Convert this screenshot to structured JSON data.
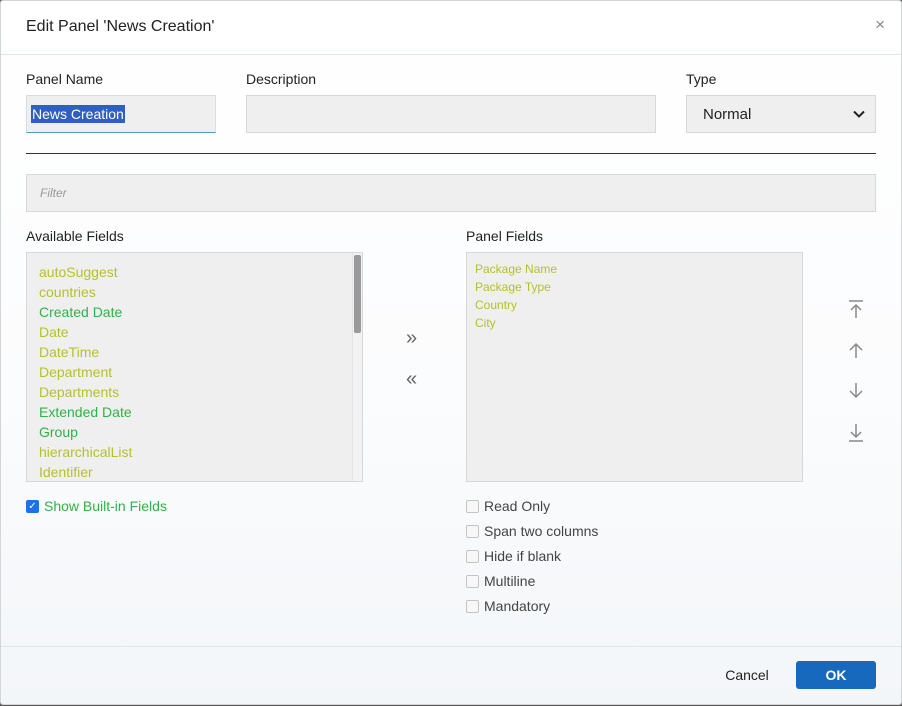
{
  "dialog": {
    "title": "Edit Panel 'News Creation'",
    "close_glyph": "×"
  },
  "form": {
    "panel_name_label": "Panel Name",
    "panel_name_value": "News Creation",
    "description_label": "Description",
    "description_value": "",
    "type_label": "Type",
    "type_value": "Normal",
    "filter_placeholder": "Filter"
  },
  "available_fields": {
    "label": "Available Fields",
    "items": [
      {
        "label": "autoSuggest",
        "color": "#b5c12a"
      },
      {
        "label": "countries",
        "color": "#b5c12a"
      },
      {
        "label": "Created Date",
        "color": "#2fb346"
      },
      {
        "label": "Date",
        "color": "#b5c12a"
      },
      {
        "label": "DateTime",
        "color": "#b5c12a"
      },
      {
        "label": "Department",
        "color": "#b5c12a"
      },
      {
        "label": "Departments",
        "color": "#b5c12a"
      },
      {
        "label": "Extended Date",
        "color": "#2fb346"
      },
      {
        "label": "Group",
        "color": "#2fb346"
      },
      {
        "label": "hierarchicalList",
        "color": "#b5c12a"
      },
      {
        "label": "Identifier",
        "color": "#b5c12a"
      }
    ]
  },
  "panel_fields": {
    "label": "Panel Fields",
    "items": [
      {
        "label": "Package Name",
        "color": "#b5c12a"
      },
      {
        "label": "Package Type",
        "color": "#b5c12a"
      },
      {
        "label": "Country",
        "color": "#b5c12a"
      },
      {
        "label": "City",
        "color": "#b5c12a"
      }
    ]
  },
  "transfer": {
    "add_glyph": "»",
    "remove_glyph": "«"
  },
  "order_icons": [
    "move-top-icon",
    "move-up-icon",
    "move-down-icon",
    "move-bottom-icon"
  ],
  "options": {
    "show_builtin_label": "Show Built-in Fields",
    "show_builtin_checked": true,
    "read_only": "Read Only",
    "span_two_columns": "Span two columns",
    "hide_if_blank": "Hide if blank",
    "multiline": "Multiline",
    "mandatory": "Mandatory"
  },
  "footer": {
    "cancel_label": "Cancel",
    "ok_label": "OK"
  },
  "colors": {
    "accent": "#1669bd",
    "builtin_field": "#2fb346",
    "custom_field": "#b5c12a"
  }
}
